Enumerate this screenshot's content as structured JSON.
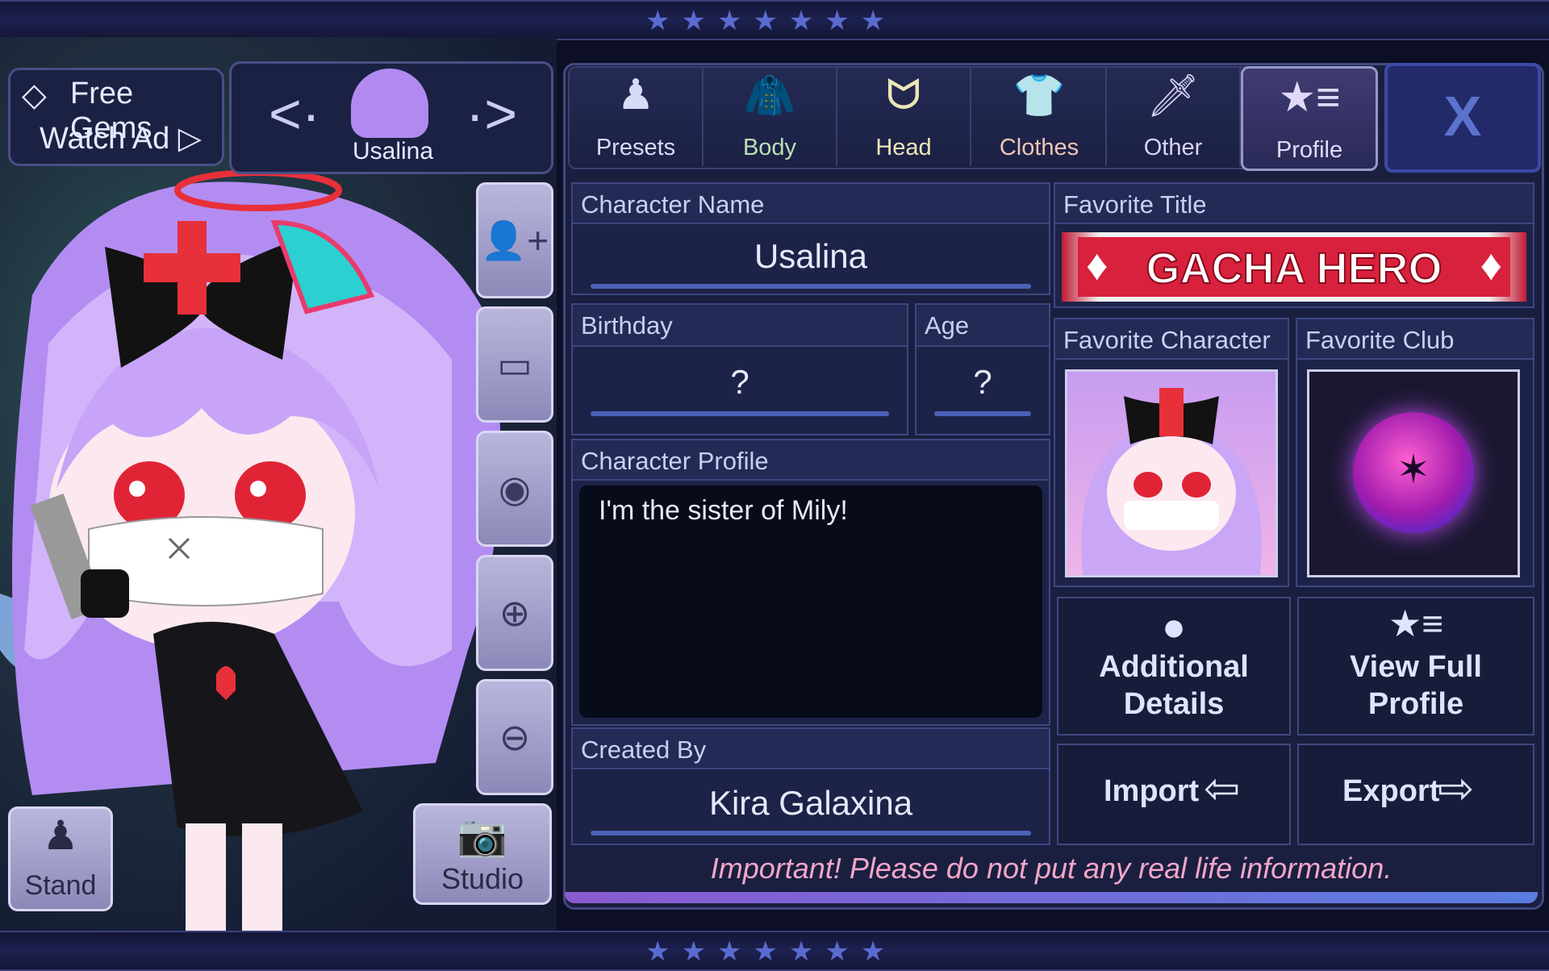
{
  "gems": {
    "line1": "Free Gems",
    "line2": "Watch Ad ▷"
  },
  "character": {
    "name": "Usalina",
    "prev": "<·",
    "next": "·>"
  },
  "left_buttons": {
    "stand": "Stand",
    "studio": "Studio"
  },
  "tabs": [
    {
      "label": "Presets",
      "icon": "person-icon",
      "color": "#d7dbf6"
    },
    {
      "label": "Body",
      "icon": "jacket-icon",
      "color": "#b9e0b4"
    },
    {
      "label": "Head",
      "icon": "hair-icon",
      "color": "#ece6b6"
    },
    {
      "label": "Clothes",
      "icon": "shirt-icon",
      "color": "#f2c6b4"
    },
    {
      "label": "Other",
      "icon": "sword-cat-icon",
      "color": "#d9d2f2"
    },
    {
      "label": "Profile",
      "icon": "star-list-icon",
      "color": "#e0d9f8"
    }
  ],
  "close_label": "X",
  "profile": {
    "name_label": "Character Name",
    "name_value": "Usalina",
    "birthday_label": "Birthday",
    "birthday_value": "?",
    "age_label": "Age",
    "age_value": "?",
    "profile_label": "Character Profile",
    "profile_value": "I'm the sister of Mily!",
    "created_label": "Created By",
    "created_value": "Kira Galaxina",
    "fav_title_label": "Favorite Title",
    "fav_title_value": "GACHA HERO",
    "fav_char_label": "Favorite Character",
    "fav_club_label": "Favorite Club"
  },
  "actions": {
    "additional": "Additional Details",
    "view_full": "View Full Profile",
    "import": "Import",
    "export": "Export"
  },
  "warning": "Important! Please do not put any real life information.",
  "colors": {
    "accent": "#4a63b8",
    "warning": "#f2a6c8",
    "title_banner": "#d8213d"
  }
}
